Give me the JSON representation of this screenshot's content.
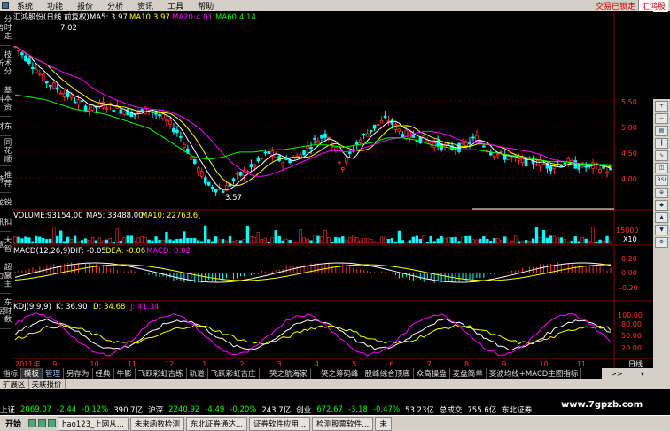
{
  "menu": [
    "系统",
    "功能",
    "报价",
    "分析",
    "资讯",
    "工具",
    "帮助"
  ],
  "menu_right": {
    "trade": "交易已锁定",
    "broker": "汇鸿股"
  },
  "left_tabs": [
    "分时走势",
    "技术分析",
    "基本资料",
    "东财",
    "同花顺",
    "推荐特",
    "锐龙",
    "扣讯",
    "大智慧",
    "超赢主力",
    "东财数据"
  ],
  "price_panel": {
    "title": "汇鸿股份(日线 前复权)",
    "ma5_label": "MA5:",
    "ma5": "3.97",
    "ma10_label": "MA10:",
    "ma10": "3.97",
    "ma20_label": "MA20:",
    "ma20": "4.01",
    "ma60_label": "MA60:",
    "ma60": "4.14",
    "high_mark": "7.02",
    "low_mark": "3.57",
    "y_ticks": [
      "5.50",
      "5.00",
      "4.50",
      "4.00"
    ],
    "left_ticks": [
      "10",
      "10",
      "10",
      "10",
      "10",
      "10",
      "10",
      "10"
    ]
  },
  "volume_panel": {
    "label": "VOLUME:",
    "volume": "93154.00",
    "ma5_label": "MA5:",
    "ma5": "33488.00",
    "ma10_label": "MA10:",
    "ma10": "22763.6(",
    "y_ticks": [
      "15000",
      "X10"
    ]
  },
  "macd_panel": {
    "label": "MACD(12,26,9)",
    "dif": "DIF: -0.05",
    "dea": "DEA: -0.06",
    "macd": "MACD: 0.02",
    "y_ticks": [
      "0.20",
      "0.00",
      "-0.20"
    ],
    "left_ticks": [
      "10",
      "10",
      "10",
      "10"
    ]
  },
  "kdj_panel": {
    "label": "KDJ(9,9,9)",
    "k": "K: 36.90",
    "d": "D: 34.68",
    "j": "J: 41.34",
    "y_ticks": [
      "100.00",
      "80.00",
      "50.00",
      "20.00"
    ],
    "right_ticks": [
      "5",
      "5",
      "9",
      "5",
      "9",
      "9",
      "6",
      "5",
      "9"
    ]
  },
  "date_axis": {
    "labels": [
      "2011年",
      "9",
      "10",
      "11",
      "12",
      "1",
      "2",
      "3",
      "4",
      "5",
      "6",
      "7",
      "8",
      "9",
      "10",
      "11"
    ],
    "period": "日线"
  },
  "tabs": [
    "指标",
    "模板",
    "管理",
    "另存为",
    "经典",
    "牛影",
    "飞跃彩虹吉练",
    "轨道",
    "飞跃彩虹吉庄",
    "一笑之航海家",
    "一笑之筹码峰",
    "股峰综合顶底",
    "众高操盘",
    "麦盘简单",
    "斐波均线+MACD主图指标"
  ],
  "tab_tail": [
    ">>",
    "▾"
  ],
  "ext_tabs": [
    "扩展区",
    "关联报价"
  ],
  "ticker": [
    {
      "name": "上证",
      "value": "2069.07",
      "chg": "-2.44",
      "pct": "-0.12%",
      "amt": "390.7亿"
    },
    {
      "name": "沪深",
      "value": "2240.92",
      "chg": "-4.49",
      "pct": "-0.20%",
      "amt": "243.7亿"
    },
    {
      "name": "创业",
      "value": "672.67",
      "chg": "-3.18",
      "pct": "-0.47%",
      "amt": "53.23亿"
    },
    {
      "name": "总成交",
      "value": "755.6亿"
    },
    {
      "name": "东北证券",
      "value": ""
    }
  ],
  "taskbar": {
    "start": "开始",
    "items": [
      "hao123_上网从...",
      "未来函数检测",
      "东北证券通达...",
      "证券软件应用...",
      "检测股票软件...",
      "未"
    ]
  },
  "watermark": "www.7gpzb.com",
  "colors": {
    "up": "#ff3333",
    "down": "#00ffff",
    "ma5": "#ffffff",
    "ma10": "#ffff00",
    "ma20": "#ff00ff",
    "ma60": "#00ff00",
    "grid": "#880000"
  },
  "chart_data": {
    "type": "candlestick",
    "title": "汇鸿股份(日线 前复权)",
    "x_labels": [
      "2011年",
      "9",
      "10",
      "11",
      "12",
      "1",
      "2",
      "3",
      "4",
      "5",
      "6",
      "7",
      "8",
      "9",
      "10",
      "11"
    ],
    "ylim": [
      3.4,
      7.1
    ],
    "close_path": [
      6.6,
      6.3,
      5.9,
      5.7,
      5.5,
      5.3,
      5.4,
      5.3,
      5.2,
      5.3,
      5.1,
      4.8,
      4.2,
      3.7,
      3.6,
      3.9,
      4.1,
      4.4,
      4.2,
      4.3,
      4.6,
      4.8,
      4.1,
      4.6,
      4.9,
      5.1,
      4.8,
      4.7,
      4.6,
      4.5,
      4.5,
      4.7,
      4.4,
      4.3,
      4.2,
      4.2,
      4.1,
      4.2,
      4.1,
      4.1,
      4.0
    ],
    "ma60_path": [
      5.6,
      5.55,
      5.5,
      5.4,
      5.3,
      5.25,
      5.2,
      5.1,
      5.0,
      4.9,
      4.7,
      4.5,
      4.3,
      4.25,
      4.3,
      4.4,
      4.4,
      4.45,
      4.45,
      4.5,
      4.55,
      4.55,
      4.5,
      4.55,
      4.6,
      4.7,
      4.7,
      4.65,
      4.55,
      4.5,
      4.45,
      4.45,
      4.4,
      4.35,
      4.3,
      4.25,
      4.2,
      4.2,
      4.15,
      4.14,
      4.14
    ]
  }
}
